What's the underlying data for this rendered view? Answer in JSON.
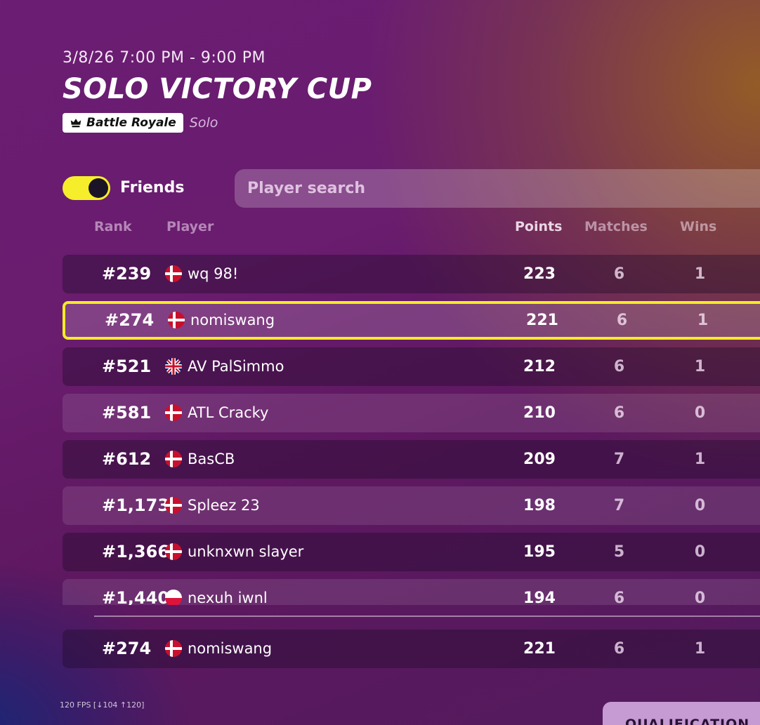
{
  "event": {
    "date_range": "3/8/26 7:00 PM - 9:00 PM",
    "title": "SOLO VICTORY CUP",
    "mode_badge": "Battle Royale",
    "mode_icon": "crown-icon",
    "team_type": "Solo"
  },
  "filters": {
    "friends_toggle_on": true,
    "friends_label": "Friends",
    "search_placeholder": "Player search",
    "search_value": ""
  },
  "colors": {
    "highlight_border": "#f3ec26",
    "toggle_on": "#f6ee2a"
  },
  "columns": {
    "rank": "Rank",
    "player": "Player",
    "points": "Points",
    "matches": "Matches",
    "wins": "Wins"
  },
  "rows": [
    {
      "rank": "#239",
      "flag": "denmark-flag",
      "player": "wq 98!",
      "points": "223",
      "matches": "6",
      "wins": "1"
    },
    {
      "rank": "#274",
      "flag": "denmark-flag",
      "player": "nomiswang",
      "points": "221",
      "matches": "6",
      "wins": "1"
    },
    {
      "rank": "#521",
      "flag": "uk-flag",
      "player": "AV PalSimmo",
      "points": "212",
      "matches": "6",
      "wins": "1"
    },
    {
      "rank": "#581",
      "flag": "denmark-flag",
      "player": "ATL Cracky",
      "points": "210",
      "matches": "6",
      "wins": "0"
    },
    {
      "rank": "#612",
      "flag": "denmark-flag",
      "player": "BasCB",
      "points": "209",
      "matches": "7",
      "wins": "1"
    },
    {
      "rank": "#1,173",
      "flag": "denmark-flag",
      "player": "Spleez 23",
      "points": "198",
      "matches": "7",
      "wins": "0"
    },
    {
      "rank": "#1,366",
      "flag": "denmark-flag",
      "player": "unknxwn slayer",
      "points": "195",
      "matches": "5",
      "wins": "0"
    },
    {
      "rank": "#1,440",
      "flag": "poland-flag",
      "player": "nexuh iwnl",
      "points": "194",
      "matches": "6",
      "wins": "0"
    }
  ],
  "pinned_row": {
    "rank": "#274",
    "flag": "denmark-flag",
    "player": "nomiswang",
    "points": "221",
    "matches": "6",
    "wins": "1"
  },
  "fps_overlay": "120 FPS [↓104 ↑120]",
  "qualification_button": "QUALIFICATION"
}
